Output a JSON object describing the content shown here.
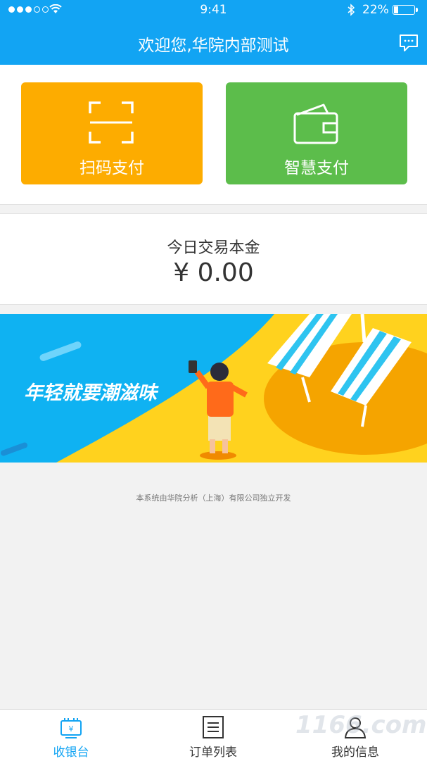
{
  "status_bar": {
    "time": "9:41",
    "battery": "22%"
  },
  "header": {
    "title": "欢迎您,华院内部测试"
  },
  "payments": [
    {
      "label": "扫码支付",
      "color": "#fdac00",
      "icon": "scan-icon"
    },
    {
      "label": "智慧支付",
      "color": "#5cbd4b",
      "icon": "wallet-icon"
    }
  ],
  "today": {
    "label": "今日交易本金",
    "amount": "¥ 0.00"
  },
  "banner": {
    "slogan": "年轻就要潮滋味"
  },
  "footer": {
    "text": "本系统由华院分析（上海）有限公司独立开发"
  },
  "tabs": [
    {
      "label": "收银台",
      "icon": "register-icon",
      "active": true
    },
    {
      "label": "订单列表",
      "icon": "list-icon",
      "active": false
    },
    {
      "label": "我的信息",
      "icon": "user-icon",
      "active": false
    }
  ],
  "watermark": "1166.com",
  "colors": {
    "primary": "#12a4f3",
    "scan": "#fdac00",
    "smart": "#5cbd4b"
  }
}
